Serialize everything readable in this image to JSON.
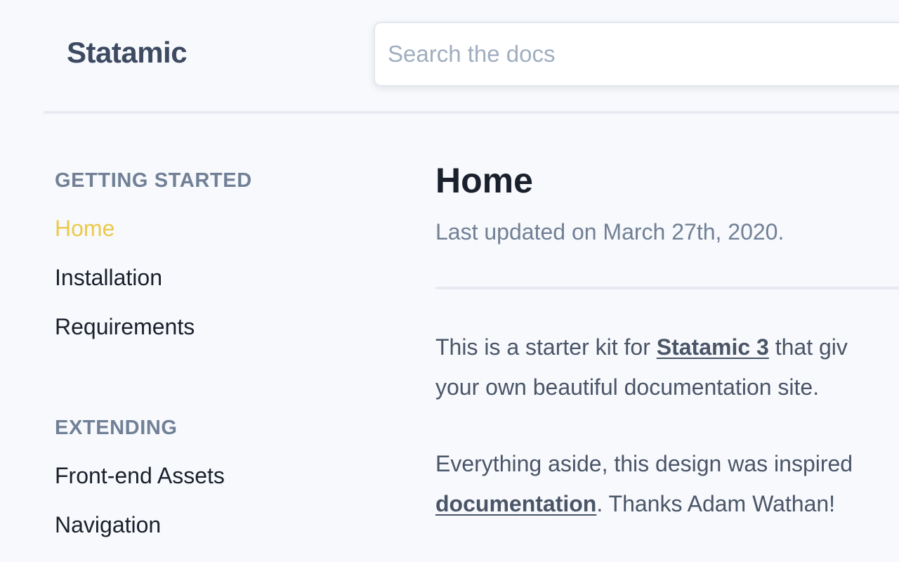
{
  "header": {
    "logo": "Statamic",
    "search_placeholder": "Search the docs"
  },
  "sidebar": {
    "sections": [
      {
        "heading": "GETTING STARTED",
        "items": [
          "Home",
          "Installation",
          "Requirements"
        ]
      },
      {
        "heading": "EXTENDING",
        "items": [
          "Front-end Assets",
          "Navigation"
        ]
      }
    ],
    "active_item": "Home"
  },
  "main": {
    "title": "Home",
    "updated": "Last updated on March 27th, 2020.",
    "paragraphs": [
      {
        "lines": [
          {
            "before": "This is a starter kit for ",
            "link": "Statamic 3",
            "after": " that giv"
          },
          {
            "text": "your own beautiful documentation site."
          }
        ]
      },
      {
        "lines": [
          {
            "text": "Everything aside, this design was inspired"
          },
          {
            "link": "documentation",
            "after": ". Thanks Adam Wathan!"
          }
        ]
      }
    ]
  },
  "colors": {
    "background": "#f7f9fc",
    "accent_active": "#ecc94b",
    "heading_muted": "#718096",
    "text_dark": "#1a202c",
    "text_body": "#4a5568"
  }
}
